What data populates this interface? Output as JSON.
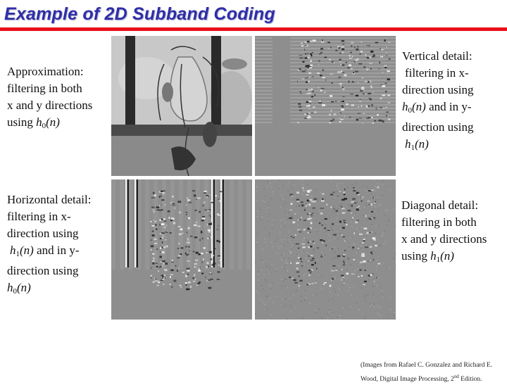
{
  "title": "Example of 2D Subband Coding",
  "colors": {
    "title": "#2e2ea8",
    "rule": "#e8101a",
    "text": "#111111"
  },
  "panels": {
    "approximation": {
      "heading": "Approximation:",
      "line2": "filtering in both",
      "line3": "x and y directions",
      "line4_prefix": "using ",
      "filter": "h",
      "sub": "0",
      "arg": "(n)"
    },
    "vertical": {
      "heading": "Vertical detail:",
      "line2": "filtering in x-",
      "line3": "direction using",
      "filter_a": "h",
      "sub_a": "0",
      "arg_a": "(n)",
      "mid": " and in y-",
      "line5": "direction using",
      "filter_b": "h",
      "sub_b": "1",
      "arg_b": "(n)"
    },
    "horizontal": {
      "heading": "Horizontal detail:",
      "line2": "filtering in x-",
      "line3": "direction using",
      "filter_a": "h",
      "sub_a": "1",
      "arg_a": "(n)",
      "mid": " and in y-",
      "line5": "direction using",
      "filter_b": "h",
      "sub_b": "0",
      "arg_b": "(n)"
    },
    "diagonal": {
      "heading": "Diagonal detail:",
      "line2": "filtering in both",
      "line3": "x and y directions",
      "line4_prefix": "using ",
      "filter": "h",
      "sub": "1",
      "arg": "(n)"
    }
  },
  "images": {
    "approximation": "approximation-subband-image",
    "vertical": "vertical-detail-subband-image",
    "horizontal": "horizontal-detail-subband-image",
    "diagonal": "diagonal-detail-subband-image"
  },
  "citation": {
    "line1": "(Images from Rafael C. Gonzalez and Richard E.",
    "line2_prefix": "Wood, Digital Image Processing, 2",
    "line2_sup": "nd",
    "line2_suffix": " Edition."
  }
}
